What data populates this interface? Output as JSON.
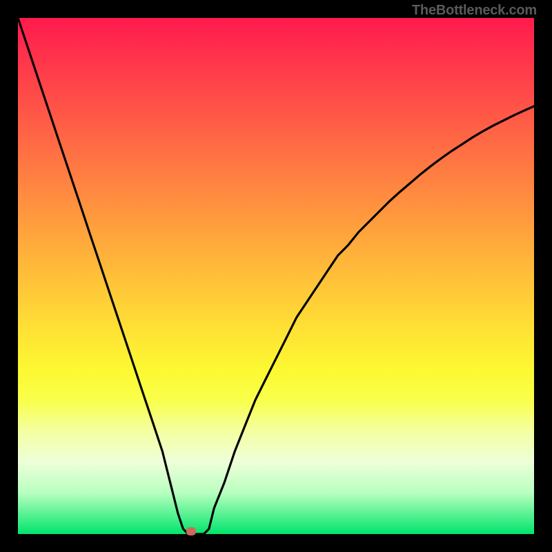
{
  "watermark": "TheBottleneck.com",
  "colors": {
    "gradient_top": "#ff1a4d",
    "gradient_bottom": "#00e56b",
    "curve": "#000000",
    "dot": "#cf6a5a",
    "frame": "#000000"
  },
  "chart_data": {
    "type": "line",
    "title": "",
    "xlabel": "",
    "ylabel": "",
    "xlim": [
      0,
      100
    ],
    "ylim": [
      0,
      100
    ],
    "x": [
      0,
      2,
      4,
      6,
      8,
      10,
      12,
      14,
      16,
      18,
      20,
      22,
      24,
      26,
      28,
      30,
      31,
      32,
      33,
      34,
      35,
      36,
      37,
      38,
      40,
      42,
      44,
      46,
      48,
      50,
      52,
      54,
      56,
      58,
      60,
      62,
      64,
      66,
      68,
      70,
      72,
      74,
      76,
      78,
      80,
      82,
      84,
      86,
      88,
      90,
      92,
      94,
      96,
      98,
      100
    ],
    "y": [
      100,
      94,
      88,
      82,
      76,
      70,
      64,
      58,
      52,
      46,
      40,
      34,
      28,
      22,
      16,
      8,
      4,
      1,
      0,
      0,
      0,
      0,
      1,
      5,
      10,
      16,
      21,
      26,
      30,
      34,
      38,
      42,
      45,
      48,
      51,
      54,
      56,
      58.5,
      60.5,
      62.5,
      64.5,
      66.3,
      68,
      69.7,
      71.3,
      72.8,
      74.2,
      75.5,
      76.8,
      78,
      79.1,
      80.1,
      81.1,
      82,
      82.9
    ],
    "marker": {
      "x": 33.5,
      "y": 0
    },
    "notes": "V-shaped curve descending from top-left to a minimum near x≈33 then rising with diminishing slope toward the right edge. Background is a vertical red→green gradient indicating bottleneck severity."
  }
}
